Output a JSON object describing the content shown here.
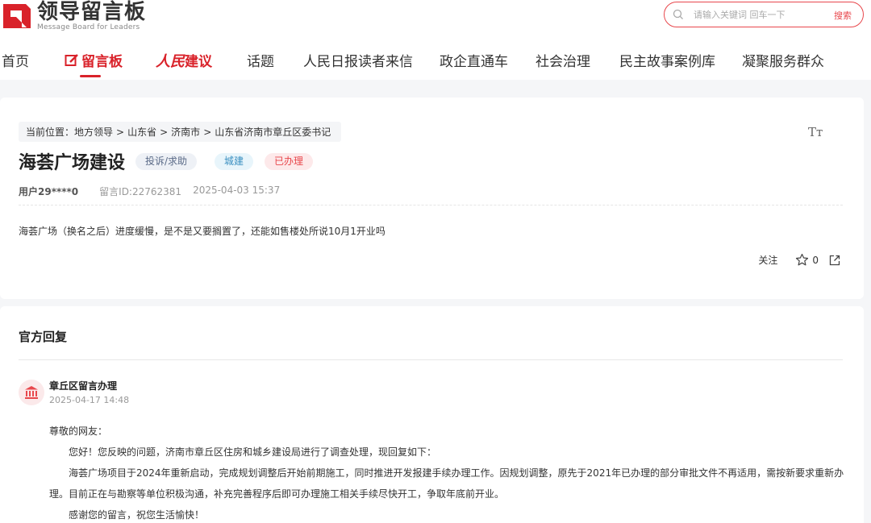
{
  "header": {
    "logo_title": "领导留言板",
    "logo_subtitle": "Message Board for Leaders",
    "search_placeholder": "请输入关键词 回车一下",
    "search_button": "搜索"
  },
  "nav": {
    "items": [
      {
        "label": "首页"
      },
      {
        "label": "留言板",
        "active": true
      },
      {
        "label_part1": "人民",
        "label_part2": "建议"
      },
      {
        "label": "话题"
      },
      {
        "label": "人民日报读者来信"
      },
      {
        "label": "政企直通车"
      },
      {
        "label": "社会治理"
      },
      {
        "label": "民主故事案例库"
      },
      {
        "label": "凝聚服务群众"
      }
    ]
  },
  "message": {
    "breadcrumb": {
      "prefix": "当前位置：",
      "items": [
        "地方领导",
        "山东省",
        "济南市",
        "山东省济南市章丘区委书记"
      ],
      "separator": ">"
    },
    "font_size_icon": "Tт",
    "title": "海荟广场建设",
    "tags": {
      "type": "投诉/求助",
      "category": "城建",
      "status": "已办理"
    },
    "user": "用户29****0",
    "message_id": "留言ID:22762381",
    "datetime": "2025-04-03 15:37",
    "content": "海荟广场（换名之后）进度缓慢，是不是又要搁置了，还能如售楼处所说10月1开业吗",
    "actions": {
      "follow": "关注",
      "star_count": "0"
    }
  },
  "reply": {
    "header": "官方回复",
    "replier": "章丘区留言办理",
    "time": "2025-04-17 14:48",
    "greeting": "尊敬的网友：",
    "paragraphs": [
      "您好！您反映的问题，济南市章丘区住房和城乡建设局进行了调查处理，现回复如下：",
      "海荟广场项目于2024年重新启动，完成规划调整后开始前期施工，同时推进开发报建手续办理工作。因规划调整，原先于2021年已办理的部分审批文件不再适用，需按新要求重新办理。目前正在与勘察等单位积极沟通，补充完善程序后即可办理施工相关手续尽快开工，争取年底前开业。",
      "感谢您的留言，祝您生活愉快！"
    ]
  },
  "colors": {
    "brand_red": "#d9222a",
    "accent_red": "#e8474c",
    "page_bg": "#f5f6f8"
  }
}
